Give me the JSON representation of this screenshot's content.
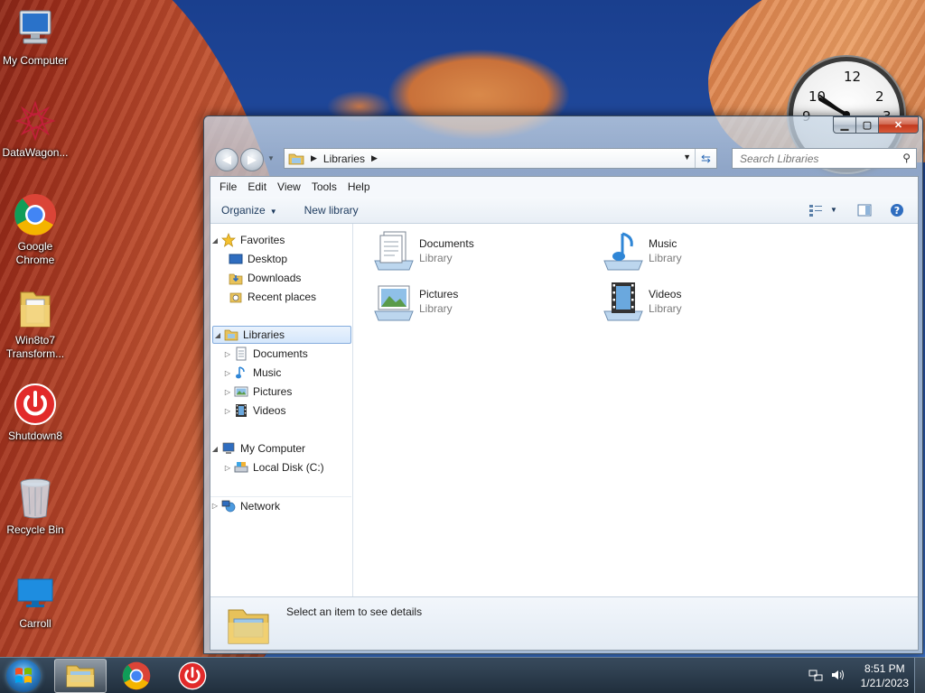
{
  "desktop": {
    "icons": [
      {
        "label": "My Computer"
      },
      {
        "label": "DataWagon..."
      },
      {
        "label": "Google Chrome"
      },
      {
        "label": "Win8to7 Transform..."
      },
      {
        "label": "Shutdown8"
      },
      {
        "label": "Recycle Bin"
      },
      {
        "label": "Carroll"
      }
    ],
    "clock": {
      "numbers": [
        "12",
        "2",
        "3",
        "9",
        "10"
      ]
    }
  },
  "explorer": {
    "address": {
      "crumb": "Libraries"
    },
    "search": {
      "placeholder": "Search Libraries"
    },
    "menu": [
      "File",
      "Edit",
      "View",
      "Tools",
      "Help"
    ],
    "commands": {
      "organize": "Organize",
      "new_library": "New library"
    },
    "nav": {
      "favorites": "Favorites",
      "desktop": "Desktop",
      "downloads": "Downloads",
      "recent": "Recent places",
      "libraries": "Libraries",
      "documents": "Documents",
      "music": "Music",
      "pictures": "Pictures",
      "videos": "Videos",
      "computer": "My Computer",
      "localdisk": "Local Disk (C:)",
      "network": "Network"
    },
    "libraries": [
      {
        "name": "Documents",
        "type": "Library"
      },
      {
        "name": "Music",
        "type": "Library"
      },
      {
        "name": "Pictures",
        "type": "Library"
      },
      {
        "name": "Videos",
        "type": "Library"
      }
    ],
    "details": "Select an item to see details"
  },
  "taskbar": {
    "time": "8:51 PM",
    "date": "1/21/2023"
  },
  "colors": {
    "selection_border": "#84acdd",
    "command_text": "#1e3b5e",
    "close_button": "#c2381d"
  }
}
